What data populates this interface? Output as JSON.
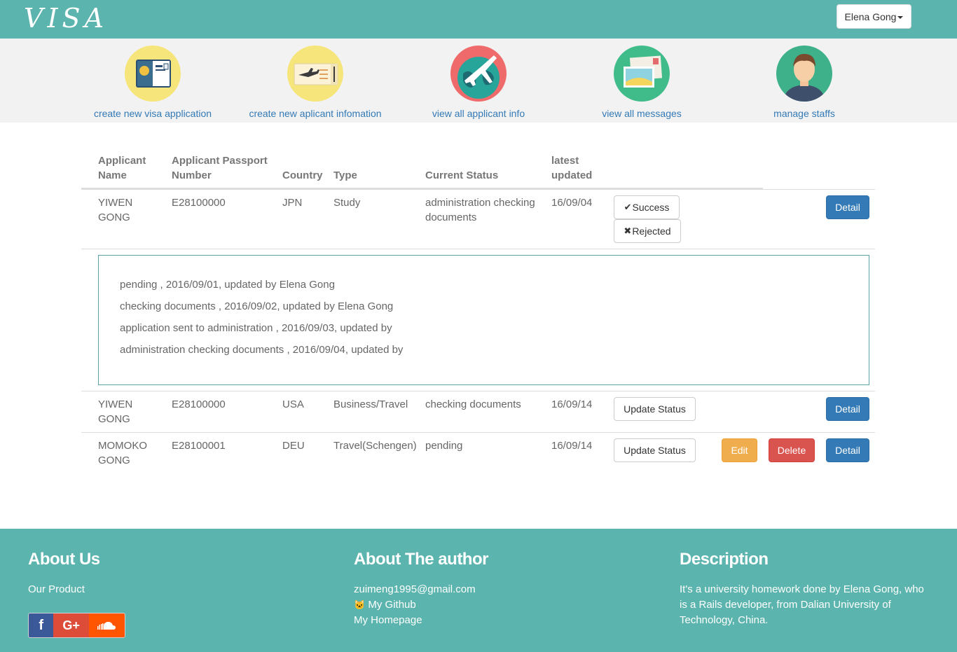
{
  "brand": "VISA",
  "user_menu": {
    "label": "Elena Gong"
  },
  "menu": [
    {
      "label": "create new visa application",
      "icon": "passport-icon"
    },
    {
      "label": "create new aplicant infomation",
      "icon": "ticket-icon"
    },
    {
      "label": "view all applicant info",
      "icon": "globe-plane-icon"
    },
    {
      "label": "view all messages",
      "icon": "postcard-icon"
    },
    {
      "label": "manage staffs",
      "icon": "staff-avatar-icon"
    }
  ],
  "table": {
    "headers": {
      "name_1": "Applicant",
      "name_2": "Name",
      "passport_1": "Applicant Passport",
      "passport_2": "Number",
      "country": "Country",
      "type": "Type",
      "status": "Current Status",
      "updated_1": "latest",
      "updated_2": "updated"
    },
    "rows": [
      {
        "name_1": "YIWEN",
        "name_2": "GONG",
        "passport": "E28100000",
        "country": "JPN",
        "type": "Study",
        "status_1": "administration checking",
        "status_2": "documents",
        "updated": "16/09/04",
        "success_label": "Success",
        "rejected_label": "Rejected",
        "detail_label": "Detail",
        "history": [
          "pending , 2016/09/01, updated by Elena Gong",
          "checking documents , 2016/09/02, updated by Elena Gong",
          "application sent to administration , 2016/09/03, updated by",
          "administration checking documents , 2016/09/04, updated by"
        ]
      },
      {
        "name_1": "YIWEN",
        "name_2": "GONG",
        "passport": "E28100000",
        "country": "USA",
        "type": "Business/Travel",
        "status": "checking documents",
        "updated": "16/09/14",
        "update_label": "Update Status",
        "detail_label": "Detail"
      },
      {
        "name_1": "MOMOKO",
        "name_2": "GONG",
        "passport": "E28100001",
        "country": "DEU",
        "type": "Travel(Schengen)",
        "status": "pending",
        "updated": "16/09/14",
        "update_label": "Update Status",
        "edit_label": "Edit",
        "delete_label": "Delete",
        "detail_label": "Detail"
      }
    ]
  },
  "footer": {
    "about_us": {
      "title": "About Us",
      "product": "Our Product"
    },
    "author": {
      "title": "About The author",
      "email": "zuimeng1995@gmail.com",
      "github": "My Github",
      "homepage": "My Homepage"
    },
    "description": {
      "title": "Description",
      "line_1": "It's a university homework done by Elena Gong, who",
      "line_2": "is a Rails developer, from Dalian University of",
      "line_3": "Technology, China."
    },
    "social": [
      {
        "glyph": "f",
        "icon": "facebook-icon",
        "color": "#3b5998"
      },
      {
        "glyph": "G+",
        "icon": "google-plus-icon",
        "color": "#dd4b39"
      },
      {
        "glyph": "",
        "icon": "soundcloud-icon",
        "color": "#ff5500"
      }
    ]
  },
  "colors": {
    "teal": "#5bb4ad",
    "link": "#337ab7",
    "primary": "#337ab7",
    "warning": "#f0ad4e",
    "danger": "#d9534f"
  }
}
